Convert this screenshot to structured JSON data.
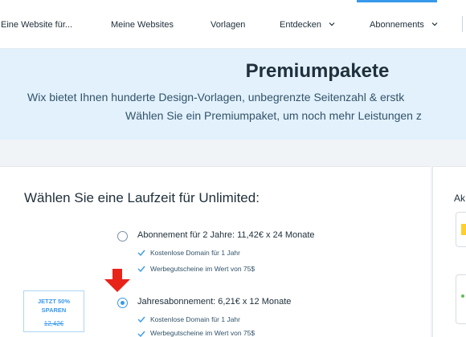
{
  "nav": {
    "items": [
      {
        "label": "Eine Website für...",
        "has_dropdown": false
      },
      {
        "label": "Meine Websites",
        "has_dropdown": false
      },
      {
        "label": "Vorlagen",
        "has_dropdown": false
      },
      {
        "label": "Entdecken",
        "has_dropdown": true
      },
      {
        "label": "Abonnements",
        "has_dropdown": true
      }
    ],
    "accent_color": "#3899ec"
  },
  "hero": {
    "title": "Premiumpakete",
    "line1": "Wix bietet Ihnen hunderte Design-Vorlagen, unbegrenzte Seitenzahl & erstk",
    "line2": "Wählen Sie ein Premiumpaket, um noch mehr Leistungen z",
    "background": "#e2f1fc"
  },
  "plans": {
    "title": "Wählen Sie eine Laufzeit für Unlimited:",
    "options": [
      {
        "label": "Abonnement für 2 Jahre: 11,42€ x 24 Monate",
        "selected": false,
        "features": [
          "Kostenlose Domain für 1 Jahr",
          "Werbegutscheine im Wert von 75$"
        ]
      },
      {
        "label": "Jahresabonnement: 6,21€ x 12 Monate",
        "selected": true,
        "features": [
          "Kostenlose Domain für 1 Jahr",
          "Werbegutscheine im Wert von 75$"
        ]
      }
    ],
    "badge": {
      "line1": "JETZT 50%",
      "line2": "SPAREN",
      "old_price": "12,42€"
    }
  },
  "sidebar": {
    "label": "Ak"
  },
  "colors": {
    "check": "#3899ec",
    "highlight_arrow": "#e8231a",
    "text": "#20303c"
  }
}
